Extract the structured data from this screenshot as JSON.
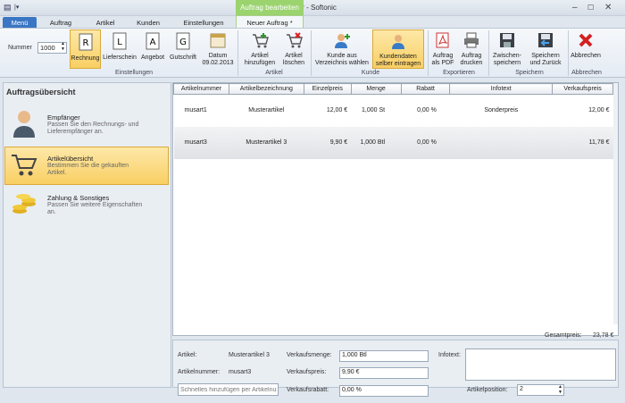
{
  "window": {
    "title": "Biller - Softonic",
    "context_tab": "Auftrag bearbeiten"
  },
  "tabs": {
    "menu": "Menü",
    "auftrag": "Auftrag",
    "artikel": "Artikel",
    "kunden": "Kunden",
    "einstellungen": "Einstellungen",
    "neuer_auftrag": "Neuer Auftrag *"
  },
  "ribbon": {
    "nummer_label": "Nummer",
    "nummer_value": "1000",
    "rechnung": "Rechnung",
    "lieferschein": "Lieferschein",
    "angebot": "Angebot",
    "gutschrift": "Gutschrift",
    "datum_label": "Datum",
    "datum_value": "09.02.2013",
    "artikel_hinzufuegen_1": "Artikel",
    "artikel_hinzufuegen_2": "hinzufügen",
    "artikel_loeschen_1": "Artikel",
    "artikel_loeschen_2": "löschen",
    "kunde_aus_1": "Kunde aus",
    "kunde_aus_2": "Verzeichnis wählen",
    "kundendaten_1": "Kundendaten",
    "kundendaten_2": "selber eintragen",
    "auftrag_pdf_1": "Auftrag",
    "auftrag_pdf_2": "als PDF",
    "auftrag_drucken_1": "Auftrag",
    "auftrag_drucken_2": "drucken",
    "zwischenspeichern_1": "Zwischen-",
    "zwischenspeichern_2": "speichern",
    "speichern_zurueck_1": "Speichern",
    "speichern_zurueck_2": "und Zurück",
    "abbrechen": "Abbrechen",
    "groups": {
      "einstellungen": "Einstellungen",
      "artikel": "Artikel",
      "kunde": "Kunde",
      "exportieren": "Exportieren",
      "speichern": "Speichern",
      "abbrechen": "Abbrechen"
    }
  },
  "sidebar": {
    "title": "Auftragsübersicht",
    "items": [
      {
        "title": "Empfänger",
        "desc1": "Passen Sie den Rechnungs- und",
        "desc2": "Lieferempfänger an."
      },
      {
        "title": "Artikelübersicht",
        "desc1": "Bestimmen Sie die gekauften",
        "desc2": "Artikel."
      },
      {
        "title": "Zahlung & Sonstiges",
        "desc1": "Passen Sie weitere Eigenschaften",
        "desc2": "an."
      }
    ]
  },
  "table": {
    "headers": [
      "Artikelnummer",
      "Artikelbezeichnung",
      "Einzelpreis",
      "Menge",
      "Rabatt",
      "Infotext",
      "Verkaufspreis"
    ],
    "rows": [
      [
        "musart1",
        "Musterartikel",
        "12,00 €",
        "1,000 St",
        "0,00 %",
        "Sonderpreis",
        "12,00 €"
      ],
      [
        "musart3",
        "Musterartikel 3",
        "9,90 €",
        "1,000 Btl",
        "0,00 %",
        "",
        "11,78 €"
      ]
    ]
  },
  "summary": {
    "label": "Gesamtpreis:",
    "value": "23,78 €"
  },
  "detail": {
    "artikel_label": "Artikel:",
    "artikel_value": "Musterartikel 3",
    "artikelnummer_label": "Artikelnummer:",
    "artikelnummer_value": "musart3",
    "quick_add_placeholder": "Schnelles hinzufügen per Artikelnu",
    "verkaufsmenge_label": "Verkaufsmenge:",
    "verkaufsmenge_value": "1,000 Btl",
    "verkaufspreis_label": "Verkaufspreis:",
    "verkaufspreis_value": "9,90 €",
    "verkaufsrabatt_label": "Verkaufsrabatt:",
    "verkaufsrabatt_value": "0,00 %",
    "infotext_label": "Infotext:",
    "artikelposition_label": "Artikelposition:",
    "artikelposition_value": "2"
  }
}
